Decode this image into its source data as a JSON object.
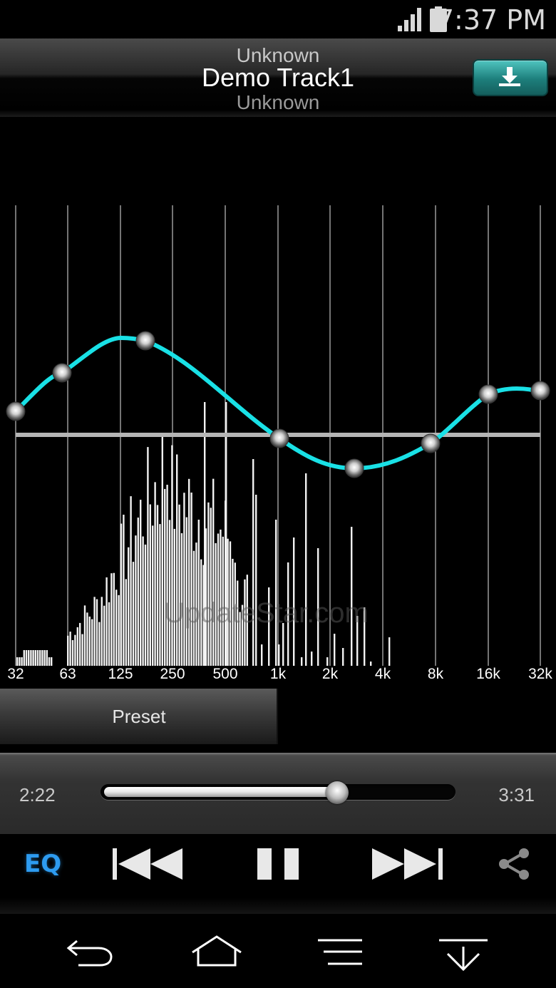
{
  "status_bar": {
    "time": "7:37 PM",
    "signal_icon": "signal-icon",
    "battery_icon": "battery-icon"
  },
  "header": {
    "artist_top": "Unknown",
    "title": "Demo Track1",
    "album": "Unknown",
    "download_icon": "download-icon",
    "accent": "#2a9a96"
  },
  "equalizer": {
    "bands": [
      "32",
      "63",
      "125",
      "250",
      "500",
      "1k",
      "2k",
      "4k",
      "8k",
      "16k",
      "32k"
    ],
    "curve_color": "#19e1e6",
    "watermark": "UpdateStar.com"
  },
  "preset": {
    "label": "Preset"
  },
  "playback": {
    "elapsed": "2:22",
    "total": "3:31",
    "progress": 0.67
  },
  "controls": {
    "eq_label": "EQ",
    "eq_color": "#2d9bf0",
    "prev_icon": "skip-previous-icon",
    "pause_icon": "pause-icon",
    "next_icon": "skip-next-icon",
    "share_icon": "share-icon"
  },
  "nav": {
    "back_icon": "back-icon",
    "home_icon": "home-icon",
    "menu_icon": "menu-icon",
    "collapse_icon": "collapse-icon"
  }
}
